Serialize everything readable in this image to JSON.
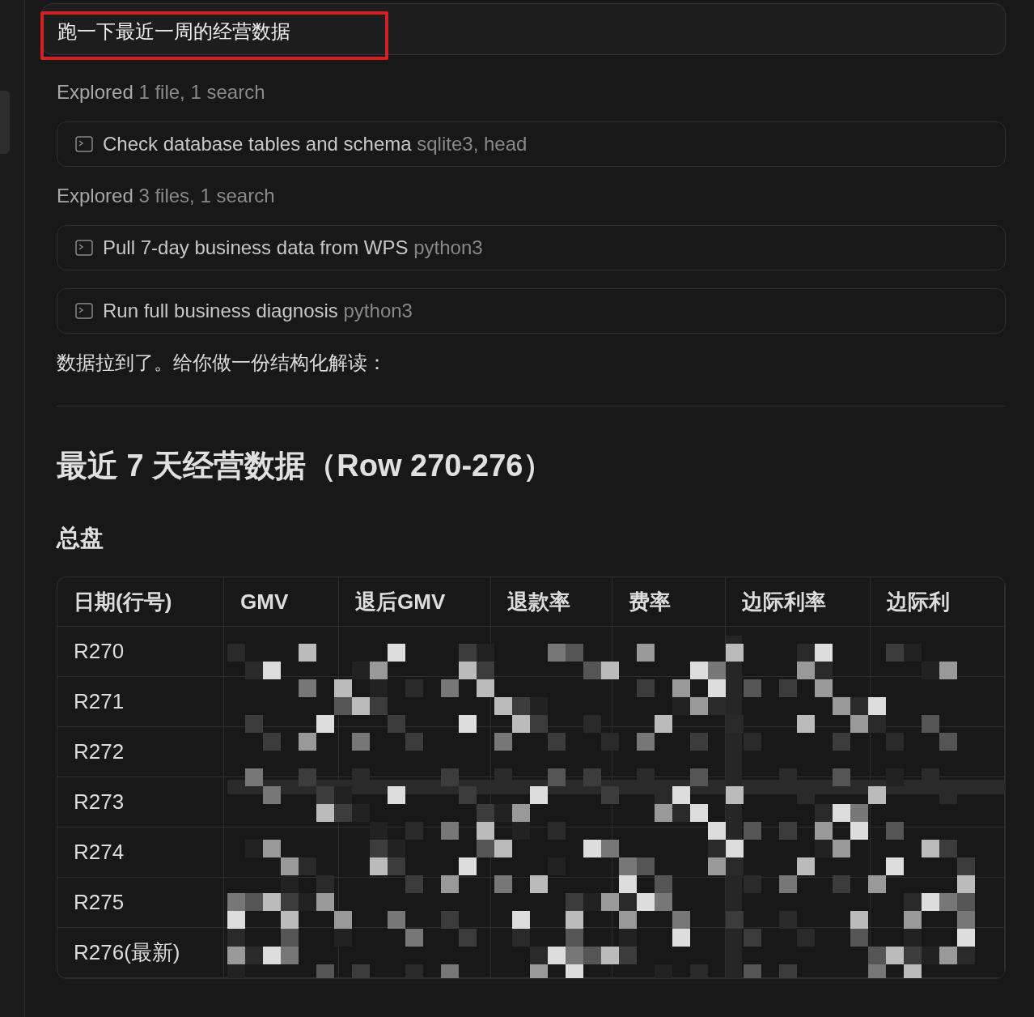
{
  "user_message": {
    "text": "跑一下最近一周的经营数据",
    "highlighted": true
  },
  "activity": [
    {
      "kind": "summary",
      "verb": "Explored",
      "detail": "1 file, 1 search"
    },
    {
      "kind": "command",
      "title": "Check database tables and schema",
      "tool": "sqlite3, head"
    },
    {
      "kind": "summary",
      "verb": "Explored",
      "detail": "3 files, 1 search"
    },
    {
      "kind": "command",
      "title": "Pull 7-day business data from WPS",
      "tool": "python3"
    },
    {
      "kind": "command",
      "title": "Run full business diagnosis",
      "tool": "python3"
    }
  ],
  "reply_intro": "数据拉到了。给你做一份结构化解读：",
  "heading": "最近 7 天经营数据（Row 270-276）",
  "subheading": "总盘",
  "table": {
    "columns": [
      "日期(行号)",
      "GMV",
      "退后GMV",
      "退款率",
      "费率",
      "边际利率",
      "边际利"
    ],
    "rows": [
      "R270",
      "R271",
      "R272",
      "R273",
      "R274",
      "R275",
      "R276(最新)"
    ]
  }
}
